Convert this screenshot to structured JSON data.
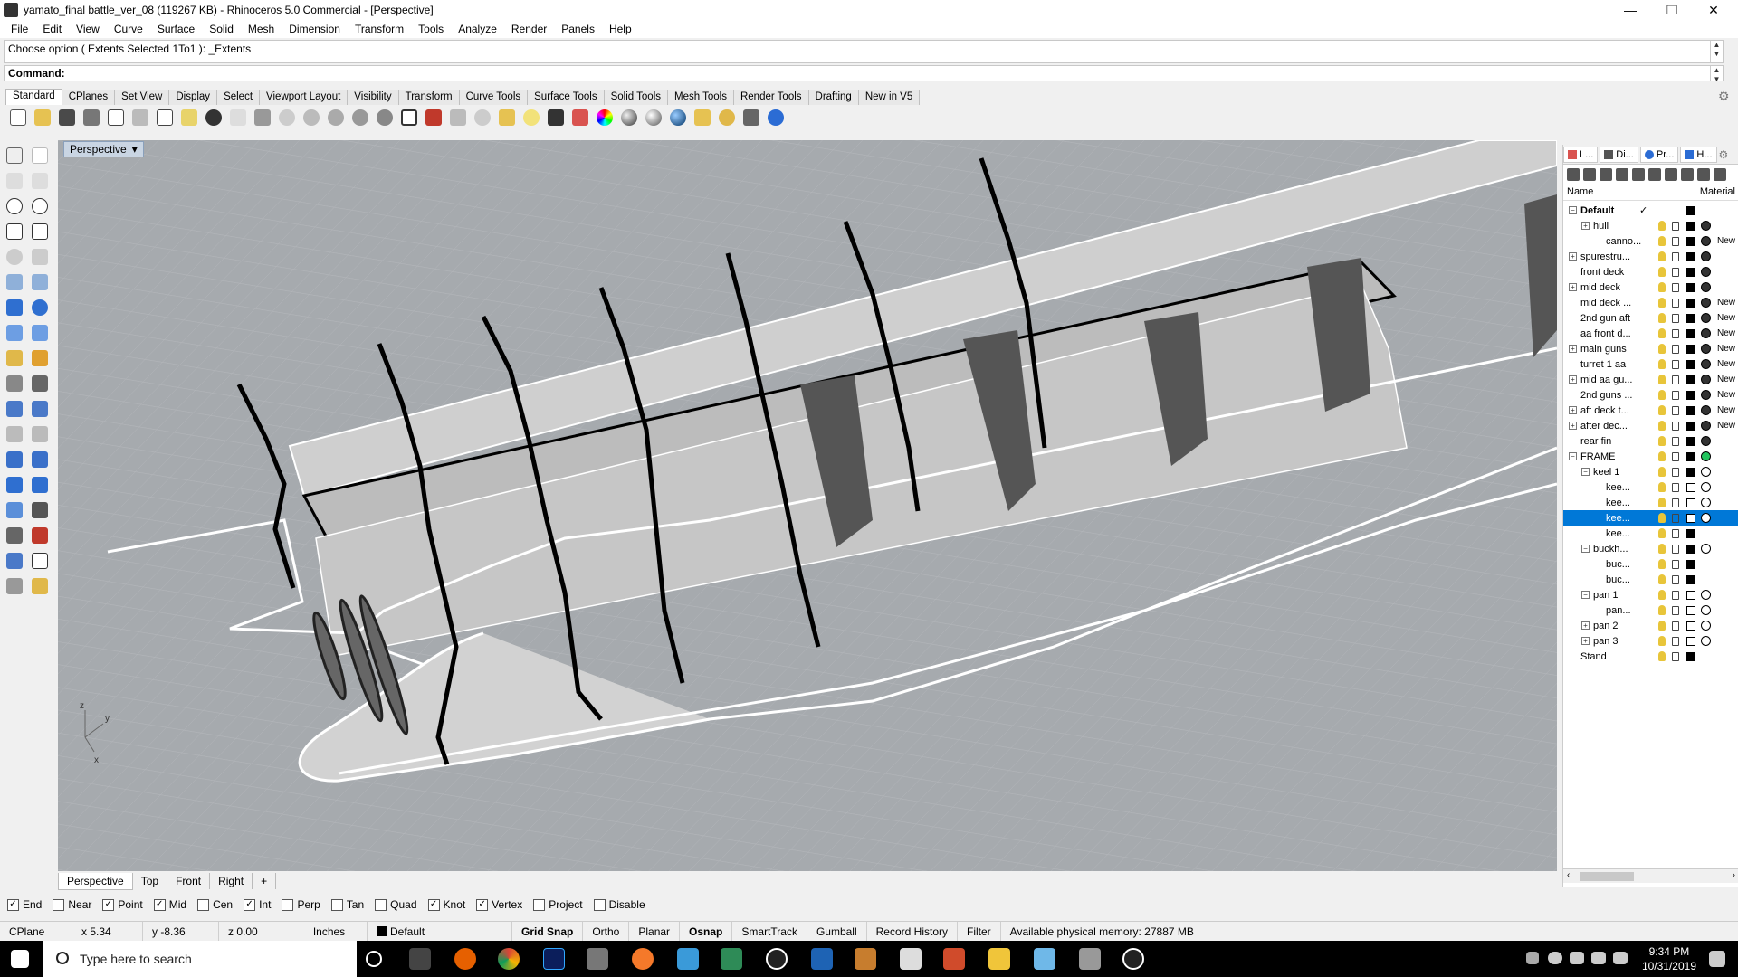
{
  "window": {
    "title": "yamato_final battle_ver_08 (119267 KB) - Rhinoceros 5.0 Commercial - [Perspective]",
    "minimize": "—",
    "maximize": "❐",
    "close": "✕"
  },
  "menu": [
    "File",
    "Edit",
    "View",
    "Curve",
    "Surface",
    "Solid",
    "Mesh",
    "Dimension",
    "Transform",
    "Tools",
    "Analyze",
    "Render",
    "Panels",
    "Help"
  ],
  "command": {
    "history": "Choose option ( Extents  Selected  1To1 ): _Extents",
    "prompt": "Command:"
  },
  "toolbar_tabs": [
    "Standard",
    "CPlanes",
    "Set View",
    "Display",
    "Select",
    "Viewport Layout",
    "Visibility",
    "Transform",
    "Curve Tools",
    "Surface Tools",
    "Solid Tools",
    "Mesh Tools",
    "Render Tools",
    "Drafting",
    "New in V5"
  ],
  "active_toolbar_tab": "Standard",
  "viewport": {
    "label": "Perspective",
    "axis_labels": {
      "z": "z",
      "y": "y",
      "x": "x"
    },
    "tabs": [
      "Perspective",
      "Top",
      "Front",
      "Right"
    ],
    "add_tab": "+"
  },
  "osnaps": [
    {
      "label": "End",
      "checked": true
    },
    {
      "label": "Near",
      "checked": false
    },
    {
      "label": "Point",
      "checked": true
    },
    {
      "label": "Mid",
      "checked": true
    },
    {
      "label": "Cen",
      "checked": false
    },
    {
      "label": "Int",
      "checked": true
    },
    {
      "label": "Perp",
      "checked": false
    },
    {
      "label": "Tan",
      "checked": false
    },
    {
      "label": "Quad",
      "checked": false
    },
    {
      "label": "Knot",
      "checked": true
    },
    {
      "label": "Vertex",
      "checked": true
    },
    {
      "label": "Project",
      "checked": false
    },
    {
      "label": "Disable",
      "checked": false
    }
  ],
  "status": {
    "cplane": "CPlane",
    "x": "x 5.34",
    "y": "y -8.36",
    "z": "z 0.00",
    "units": "Inches",
    "layer": "Default",
    "toggles": [
      "Grid Snap",
      "Ortho",
      "Planar",
      "Osnap",
      "SmartTrack",
      "Gumball",
      "Record History",
      "Filter"
    ],
    "memory": "Available physical memory: 27887 MB"
  },
  "layers_panel": {
    "tabs": [
      "L...",
      "Di...",
      "Pr...",
      "H..."
    ],
    "col_name": "Name",
    "col_material": "Material",
    "rows": [
      {
        "name": "Default",
        "indent": 0,
        "expand": "⊟",
        "bold": true,
        "check": "✓",
        "color": "#000000",
        "material": ""
      },
      {
        "name": "hull",
        "indent": 1,
        "expand": "⊞",
        "color": "#000000",
        "material": "dot"
      },
      {
        "name": "canno...",
        "indent": 2,
        "expand": "",
        "color": "#000000",
        "material": "New"
      },
      {
        "name": "spurestru...",
        "indent": 0,
        "expand": "⊞",
        "color": "#000000",
        "material": "dot"
      },
      {
        "name": "front deck",
        "indent": 0,
        "expand": "",
        "color": "#000000",
        "material": "dot"
      },
      {
        "name": "mid deck",
        "indent": 0,
        "expand": "⊞",
        "color": "#000000",
        "material": "dot"
      },
      {
        "name": "mid deck ...",
        "indent": 0,
        "expand": "",
        "color": "#000000",
        "material": "New"
      },
      {
        "name": "2nd gun aft",
        "indent": 0,
        "expand": "",
        "color": "#000000",
        "material": "New"
      },
      {
        "name": "aa front d...",
        "indent": 0,
        "expand": "",
        "color": "#000000",
        "material": "New"
      },
      {
        "name": "main guns",
        "indent": 0,
        "expand": "⊞",
        "color": "#000000",
        "material": "New"
      },
      {
        "name": "turret 1 aa",
        "indent": 0,
        "expand": "",
        "color": "#000000",
        "material": "New"
      },
      {
        "name": "mid aa gu...",
        "indent": 0,
        "expand": "⊞",
        "color": "#000000",
        "material": "New"
      },
      {
        "name": "2nd guns ...",
        "indent": 0,
        "expand": "",
        "color": "#000000",
        "material": "New"
      },
      {
        "name": "aft deck t...",
        "indent": 0,
        "expand": "⊞",
        "color": "#000000",
        "material": "New"
      },
      {
        "name": "after dec...",
        "indent": 0,
        "expand": "⊞",
        "color": "#000000",
        "material": "New"
      },
      {
        "name": "rear fin",
        "indent": 0,
        "expand": "",
        "color": "#000000",
        "material": "dot"
      },
      {
        "name": "FRAME",
        "indent": 0,
        "expand": "⊟",
        "color": "#000000",
        "material": "green"
      },
      {
        "name": "keel 1",
        "indent": 1,
        "expand": "⊟",
        "color": "#000000",
        "material": "ring"
      },
      {
        "name": "kee...",
        "indent": 2,
        "expand": "",
        "color": "#ffffff",
        "material": "ring"
      },
      {
        "name": "kee...",
        "indent": 2,
        "expand": "",
        "color": "#ffffff",
        "material": "ring"
      },
      {
        "name": "kee...",
        "indent": 2,
        "expand": "",
        "color": "#ffffff",
        "material": "ring",
        "selected": true
      },
      {
        "name": "kee...",
        "indent": 2,
        "expand": "",
        "color": "#000000",
        "material": ""
      },
      {
        "name": "buckh...",
        "indent": 1,
        "expand": "⊟",
        "color": "#000000",
        "material": "ring"
      },
      {
        "name": "buc...",
        "indent": 2,
        "expand": "",
        "color": "#000000",
        "material": ""
      },
      {
        "name": "buc...",
        "indent": 2,
        "expand": "",
        "color": "#000000",
        "material": ""
      },
      {
        "name": "pan 1",
        "indent": 1,
        "expand": "⊟",
        "color": "#ffffff",
        "material": "ring"
      },
      {
        "name": "pan...",
        "indent": 2,
        "expand": "",
        "color": "#ffffff",
        "material": "ring"
      },
      {
        "name": "pan 2",
        "indent": 1,
        "expand": "⊞",
        "color": "#ffffff",
        "material": "ring"
      },
      {
        "name": "pan 3",
        "indent": 1,
        "expand": "⊞",
        "color": "#ffffff",
        "material": "ring"
      },
      {
        "name": "Stand",
        "indent": 0,
        "expand": "",
        "color": "#000000",
        "material": ""
      }
    ]
  },
  "taskbar": {
    "search_placeholder": "Type here to search",
    "time": "9:34 PM",
    "date": "10/31/2019"
  }
}
